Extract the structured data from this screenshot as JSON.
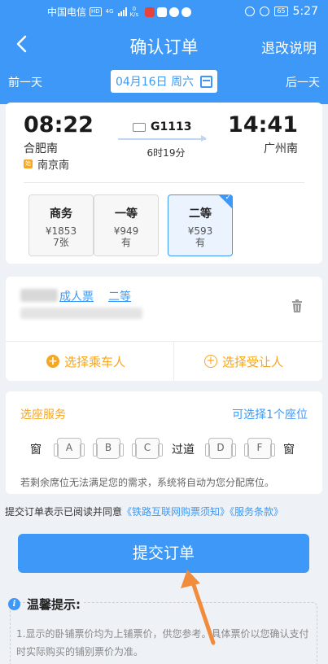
{
  "status_bar": {
    "carrier": "中国电信",
    "hd": "HD",
    "net": "4G",
    "speed": "0",
    "speed_unit": "K/s",
    "battery": "65",
    "time": "5:27"
  },
  "nav": {
    "title": "确认订单",
    "right_link": "退改说明"
  },
  "date_bar": {
    "prev": "前一天",
    "date": "04月16日 周六",
    "next": "后一天"
  },
  "train": {
    "dep_time": "08:22",
    "dep_station": "合肥南",
    "via_badge": "始",
    "via_station": "南京南",
    "train_no": "G1113",
    "duration": "6时19分",
    "arr_time": "14:41",
    "arr_station": "广州南",
    "seats": [
      {
        "name": "商务",
        "price": "¥1853",
        "avail": "7张"
      },
      {
        "name": "一等",
        "price": "¥949",
        "avail": "有"
      },
      {
        "name": "二等",
        "price": "¥593",
        "avail": "有"
      }
    ]
  },
  "passenger": {
    "ticket_type": "成人票",
    "seat_class": "二等",
    "add_passenger": "选择乘车人",
    "add_beneficiary": "选择受让人"
  },
  "seat_selection": {
    "title": "选座服务",
    "hint": "可选择1个座位",
    "window": "窗",
    "aisle": "过道",
    "letters": [
      "A",
      "B",
      "C",
      "D",
      "F"
    ],
    "note": "若剩余席位无法满足您的需求，系统将自动为您分配席位。"
  },
  "agreement": {
    "prefix": "提交订单表示已阅读并同意",
    "link1": "《铁路互联网购票须知》",
    "link2": "《服务条款》"
  },
  "submit": "提交订单",
  "tips": {
    "title": "温馨提示:",
    "text": "1.显示的卧铺票价均为上铺票价，供您参考。具体票价以您确认支付时实际购买的铺别票价为准。"
  },
  "colors": {
    "brand": "#3d98f7",
    "accent": "#f5a623",
    "annotation_arrow": "#f08c3c"
  }
}
